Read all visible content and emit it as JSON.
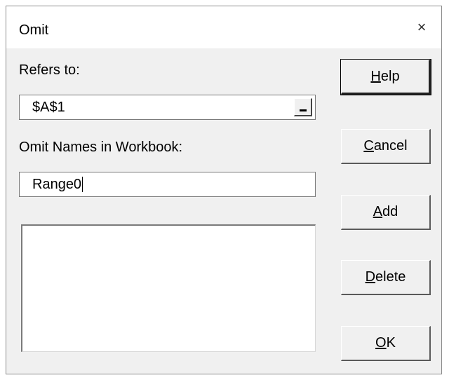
{
  "window": {
    "title": "Omit",
    "close_glyph": "×"
  },
  "refers_to": {
    "label": "Refers to:",
    "value": "$A$1"
  },
  "omit_names": {
    "label": "Omit Names in Workbook:",
    "value": "Range0",
    "list_items": []
  },
  "buttons": {
    "help": {
      "mnemonic": "H",
      "rest": "elp"
    },
    "cancel": {
      "mnemonic": "C",
      "rest": "ancel"
    },
    "add": {
      "mnemonic": "A",
      "rest": "dd"
    },
    "delete": {
      "mnemonic": "D",
      "rest": "elete"
    },
    "ok": {
      "mnemonic": "O",
      "rest": "K"
    }
  },
  "icons": {
    "collapse": "collapse-dialog-icon",
    "close": "close-icon"
  }
}
